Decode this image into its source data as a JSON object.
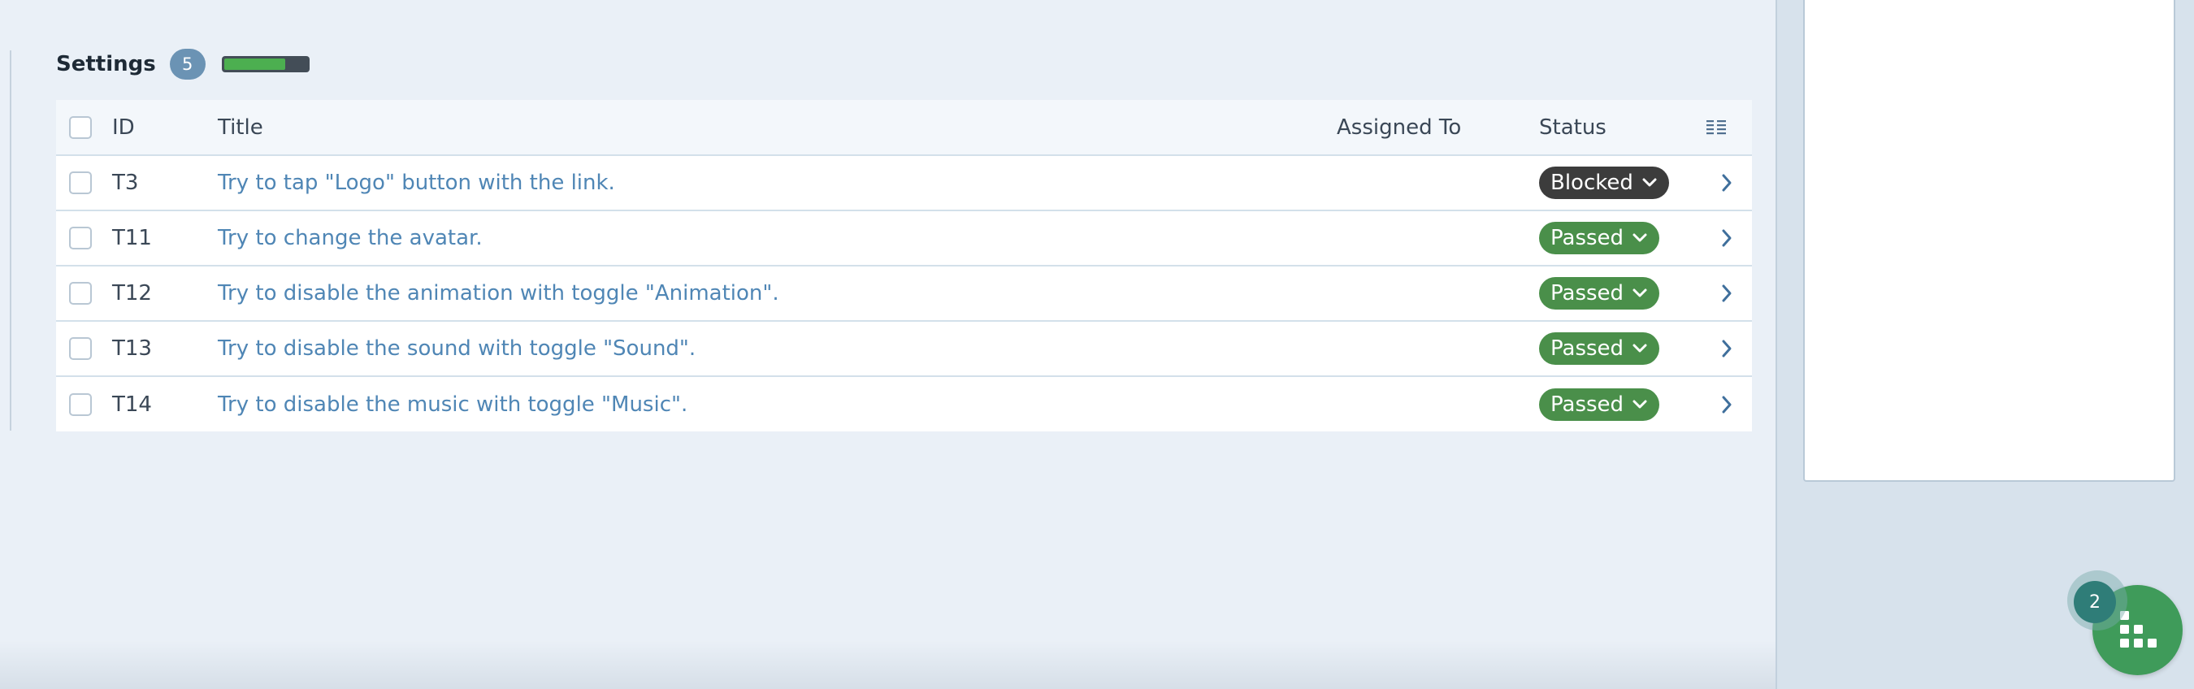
{
  "section": {
    "title": "Settings",
    "count": "5",
    "progress_fraction": 0.74,
    "progress_color": "#4caf50"
  },
  "table": {
    "headers": {
      "id": "ID",
      "title": "Title",
      "assigned_to": "Assigned To",
      "status": "Status",
      "columns_icon": "columns-icon"
    },
    "rows": [
      {
        "id": "T3",
        "title": "Try to tap \"Logo\" button with the link.",
        "assigned_to": "",
        "status": "Blocked"
      },
      {
        "id": "T11",
        "title": "Try to change the avatar.",
        "assigned_to": "",
        "status": "Passed"
      },
      {
        "id": "T12",
        "title": "Try to disable the animation with toggle \"Animation\".",
        "assigned_to": "",
        "status": "Passed"
      },
      {
        "id": "T13",
        "title": "Try to disable the sound with toggle \"Sound\".",
        "assigned_to": "",
        "status": "Passed"
      },
      {
        "id": "T14",
        "title": "Try to disable the music with toggle \"Music\".",
        "assigned_to": "",
        "status": "Passed"
      }
    ]
  },
  "status_colors": {
    "Blocked": "#3c3c3c",
    "Passed": "#4a8f4a"
  },
  "fab": {
    "badge_count": "2",
    "icon": "grid-apps-icon",
    "color": "#3f9b5a"
  }
}
